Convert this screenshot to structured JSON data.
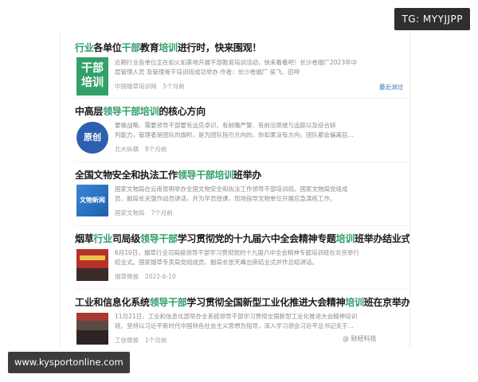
{
  "overlay": {
    "tg_badge": "TG: MYYJJPP",
    "site_url": "www.kysportonline.com",
    "watermark": "@ 财经科技"
  },
  "results": [
    {
      "title_parts": [
        {
          "text": "行业",
          "hl": true
        },
        {
          "text": "各单位",
          "hl": false
        },
        {
          "text": "干部",
          "hl": true
        },
        {
          "text": "教育",
          "hl": false
        },
        {
          "text": "培训",
          "hl": true
        },
        {
          "text": "进行时，快来围观！",
          "hl": false
        }
      ],
      "thumb": {
        "type": "logo",
        "line1": "干部",
        "line2": "培训"
      },
      "snippet_lines": [
        "近期行业各单位正在如火如荼地开展干部教育培训活动，快来看看吧！长沙卷烟厂2023年中",
        "层管理人员 及管理骨干培训班成功举办 作者：长沙卷烟厂 侯飞、田坤"
      ],
      "source": "中国烟草培训网",
      "time": "5个月前",
      "more_link": "最近浏过"
    },
    {
      "title_parts": [
        {
          "text": "中高层",
          "hl": false
        },
        {
          "text": "领导干部培训",
          "hl": true
        },
        {
          "text": "的核心方向",
          "hl": false
        }
      ],
      "thumb": {
        "type": "badge",
        "label": "原创"
      },
      "snippet_lines": [
        "要做战略、需要领导干部要有远见卓识、有前瞻严警、有前沿思维与追踪以及综合研",
        "判能力，管理者是团队的旗帜，是为团队指引方向的，你如果没有方向，团队都会偏离目..."
      ],
      "source": "北大纵横",
      "time": "8个月前"
    },
    {
      "title_parts": [
        {
          "text": "全国文物安全和执法工作",
          "hl": false
        },
        {
          "text": "领导干部培训",
          "hl": true
        },
        {
          "text": "班举办",
          "hl": false
        }
      ],
      "thumb": {
        "type": "news",
        "label": "文物新闻"
      },
      "snippet_lines": [
        "国家文物局在云南昆明举办全国文物安全和执法工作领导干部培训班。国家文物局党组成",
        "员、副局长关强作动员讲话，并为学员授课，现场指导文物单位开展应急演练工作。"
      ],
      "source": "国家文物局",
      "time": "7个月前"
    },
    {
      "title_parts": [
        {
          "text": "烟草",
          "hl": false
        },
        {
          "text": "行业",
          "hl": true
        },
        {
          "text": "司局级",
          "hl": false
        },
        {
          "text": "领导干部",
          "hl": true
        },
        {
          "text": "学习贯彻党的十九届六中全会精神专题",
          "hl": false
        },
        {
          "text": "培训",
          "hl": true
        },
        {
          "text": "班举办结业式",
          "hl": false
        }
      ],
      "thumb": {
        "type": "photo-red"
      },
      "snippet_lines": [
        "6月10日，烟草行业司局级领导干部学习贯彻党的十九届六中全会精神专题培训班在北京举行",
        "结业式。国家烟草专卖局党组成员、副局长张天峰出席结业式并作总结讲话。"
      ],
      "source": "烟草微报",
      "time": "2022-6-10"
    },
    {
      "title_parts": [
        {
          "text": "工业和信息化系统",
          "hl": false
        },
        {
          "text": "领导干部",
          "hl": true
        },
        {
          "text": "学习贯彻全国新型工业化推进大会精神",
          "hl": false
        },
        {
          "text": "培训",
          "hl": true
        },
        {
          "text": "班在京举办",
          "hl": false
        }
      ],
      "thumb": {
        "type": "photo-hall"
      },
      "snippet_lines": [
        "11月21日，工业和信息化部举办全系统领导干部学习贯彻全国新型工业化推进大会精神培训",
        "班。坚持以习近平新时代中国特色社会主义思想为指导，深入学习领会习近平总书记关于..."
      ],
      "source": "工信微报",
      "time": "1个月前"
    }
  ]
}
